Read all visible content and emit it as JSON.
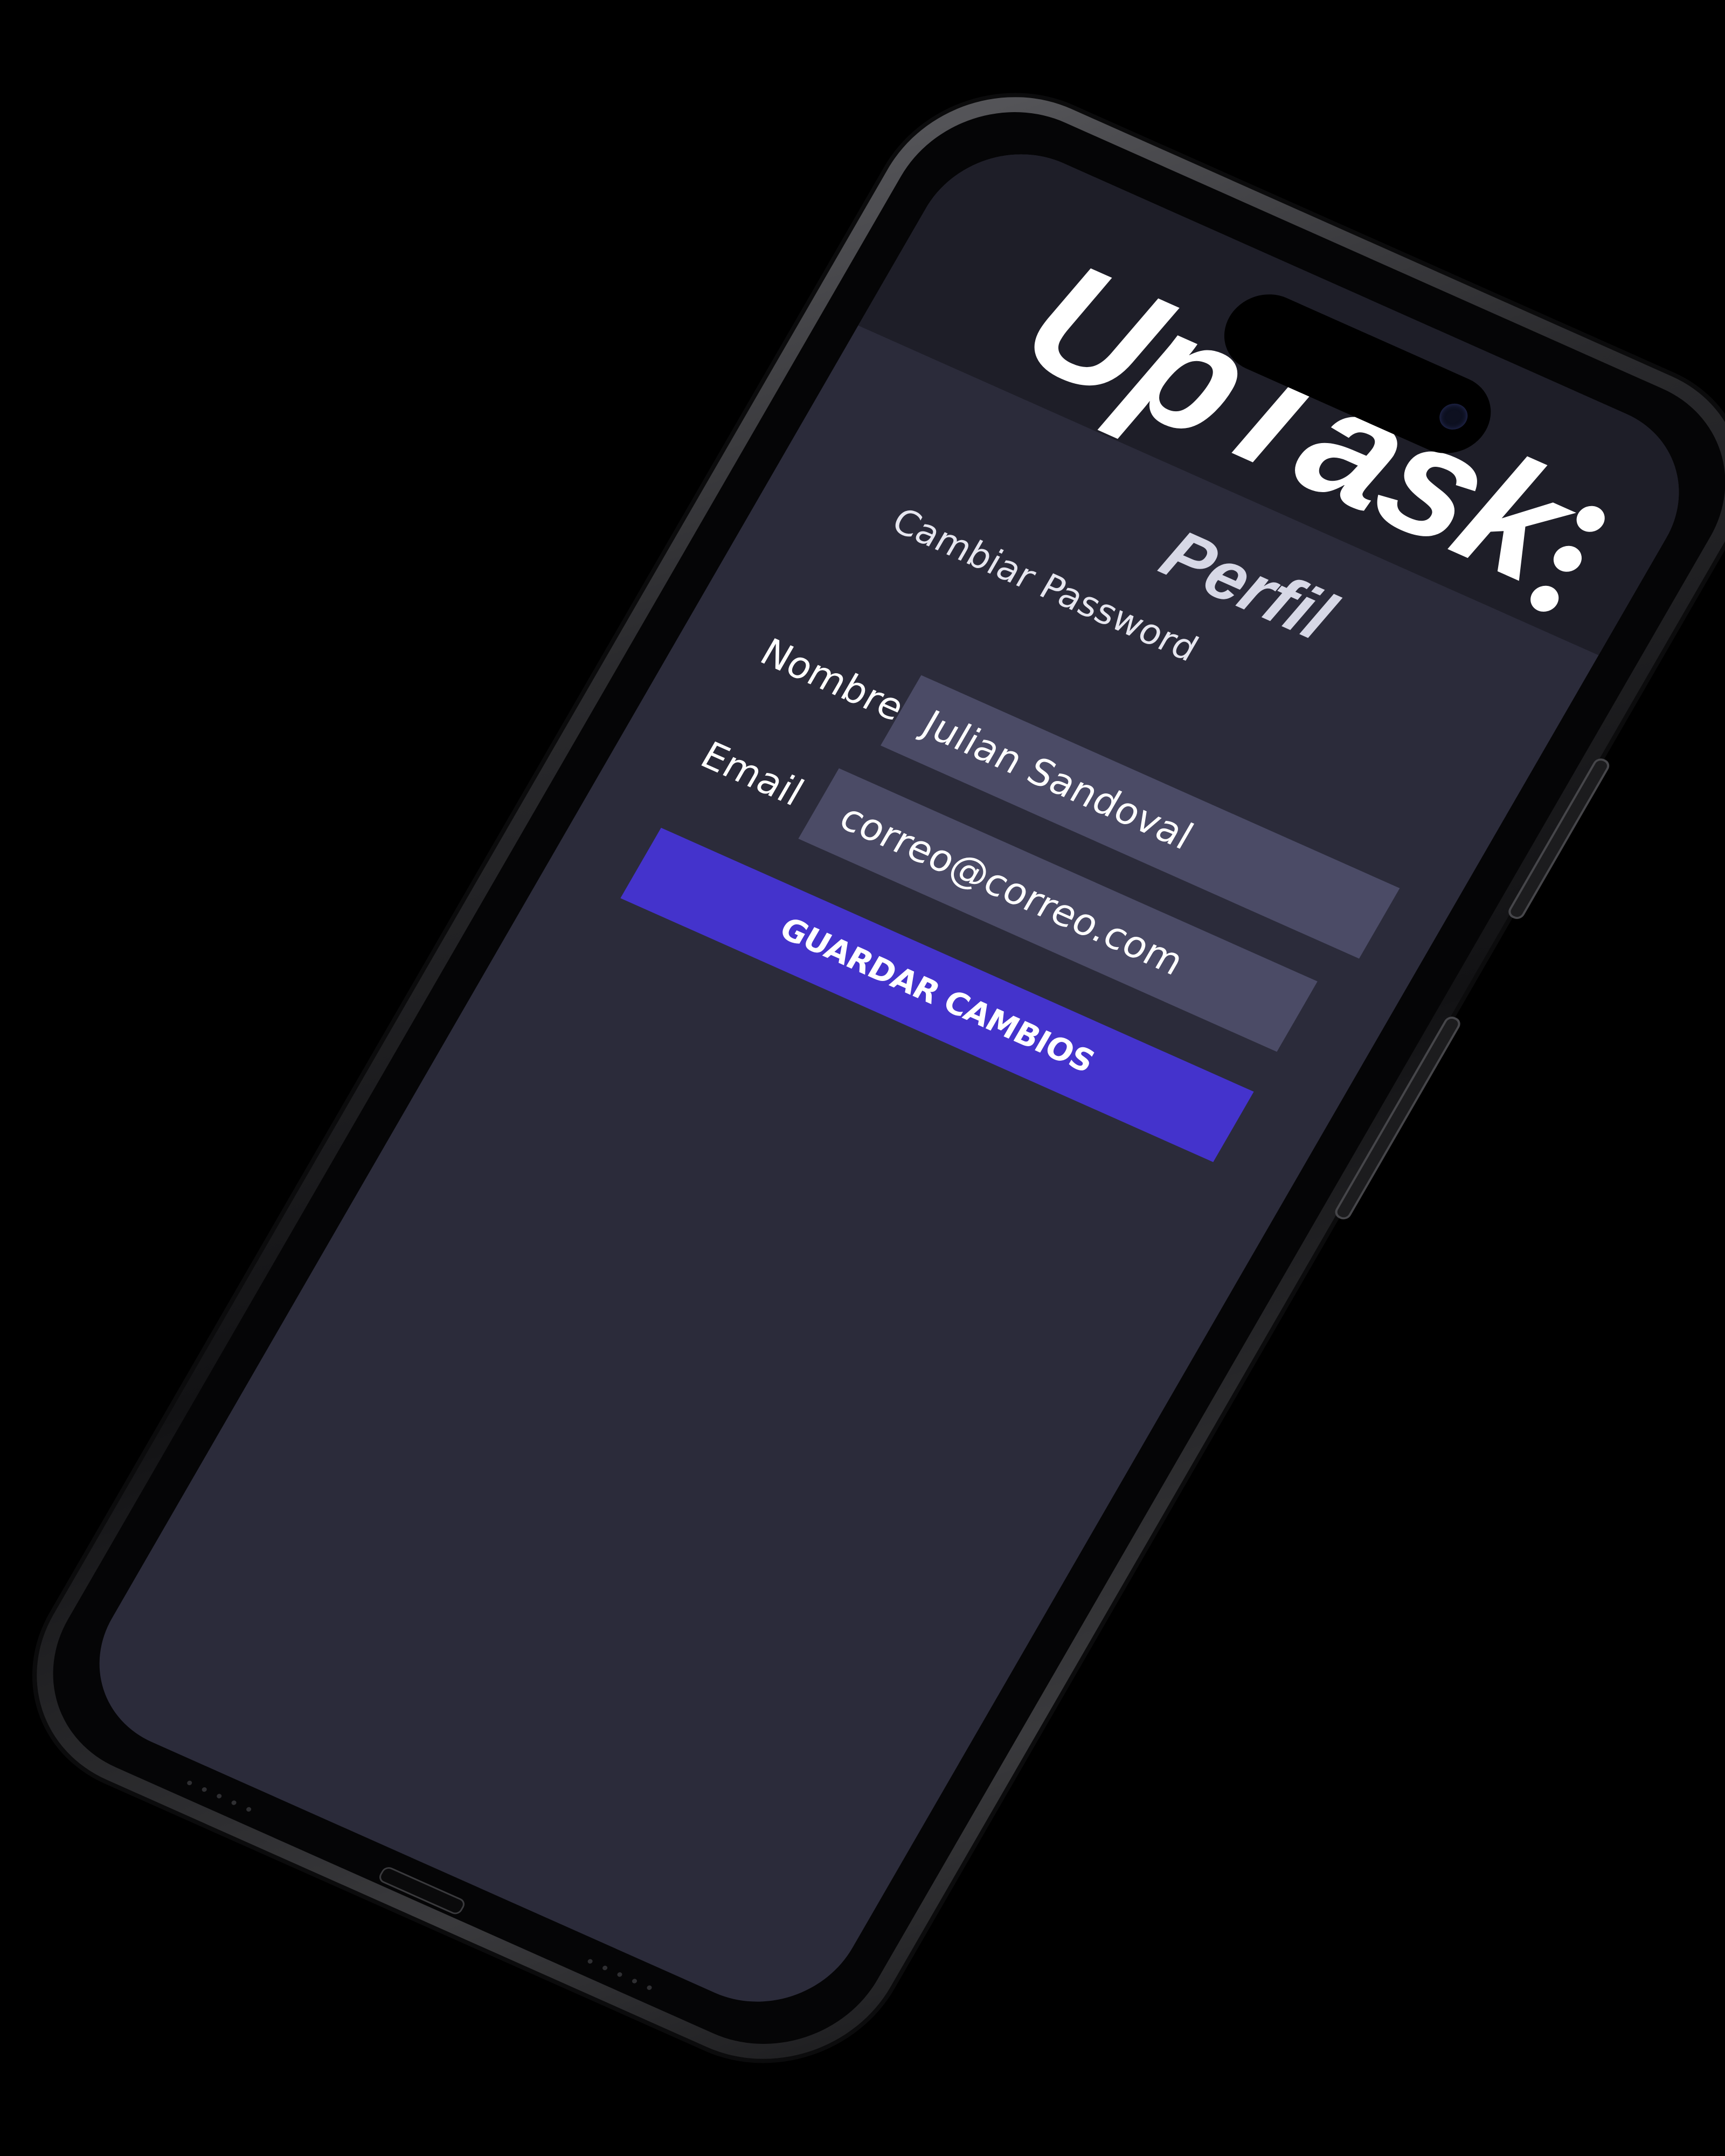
{
  "app": {
    "logo_text": "UpTask"
  },
  "header": {
    "menu_icon": "vertical-ellipsis-icon"
  },
  "page": {
    "title": "Perfil",
    "change_password_link": "Cambiar Password"
  },
  "form": {
    "name_label": "Nombre",
    "name_value": "Julian Sandoval",
    "email_label": "Email",
    "email_value": "correo@correo.com",
    "submit_label": "GUARDAR CAMBIOS"
  },
  "colors": {
    "header_bg": "#1e1e28",
    "screen_bg": "#2b2b3a",
    "input_bg": "#4b4b66",
    "button_bg": "#4433cc"
  }
}
